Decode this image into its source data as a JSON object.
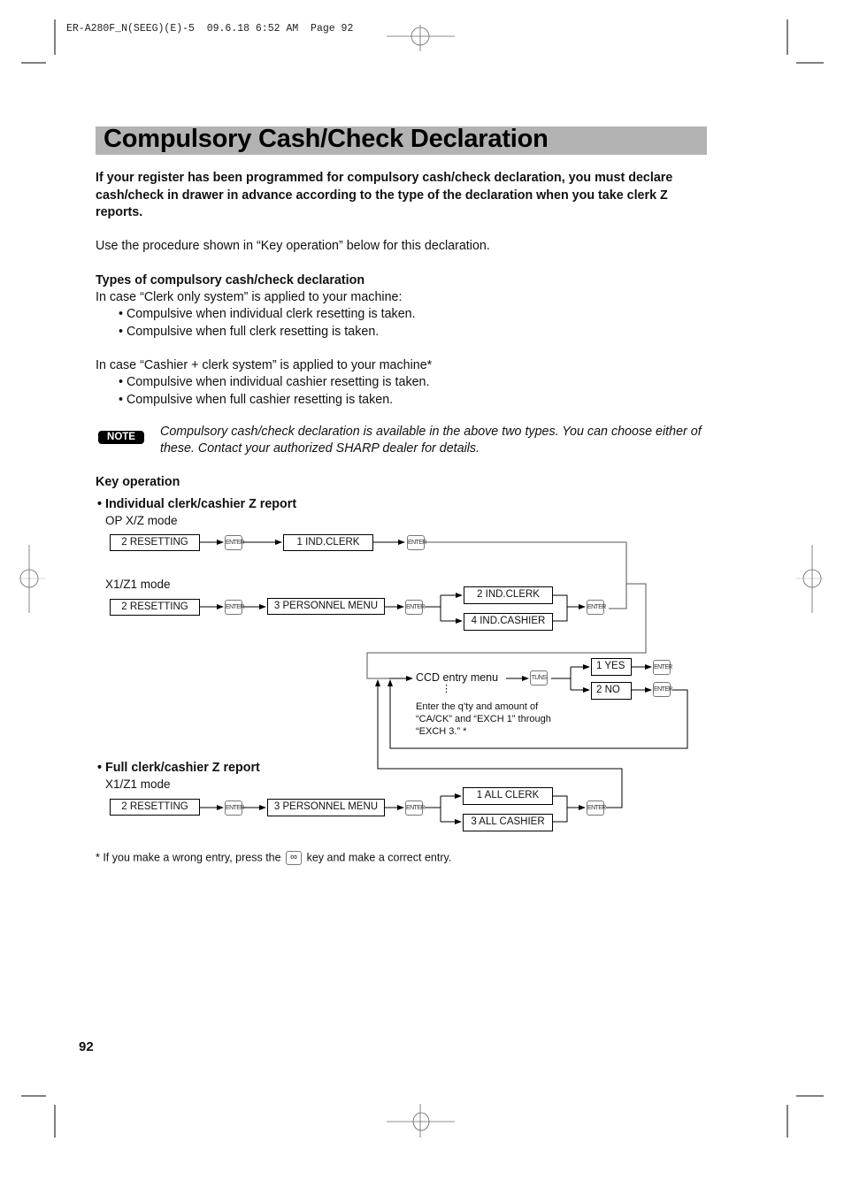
{
  "print_header": "ER-A280F_N(SEEG)(E)-5  09.6.18 6:52 AM  Page 92",
  "title": "Compulsory Cash/Check Declaration",
  "intro": "If your register has been programmed for compulsory cash/check declaration, you must declare cash/check in drawer in advance according to the type of the declaration when you take clerk Z reports.",
  "procedure_note": "Use the procedure shown in “Key operation” below for this declaration.",
  "types": {
    "heading": "Types of compulsory cash/check declaration",
    "clerk_only": {
      "intro": "In case “Clerk only system” is applied to your machine:",
      "bullets": [
        "• Compulsive when individual clerk resetting is taken.",
        "• Compulsive when full clerk resetting is taken."
      ]
    },
    "cashier_clerk": {
      "intro": "In case  “Cashier + clerk system” is applied to your machine*",
      "bullets": [
        "• Compulsive when individual cashier resetting is taken.",
        "• Compulsive when full cashier resetting is taken."
      ]
    }
  },
  "note": {
    "badge": "NOTE",
    "text": "Compulsory cash/check declaration is available in the above two types. You can choose either of these. Contact your authorized SHARP dealer for details."
  },
  "key_operation": {
    "heading": "Key operation",
    "individual": {
      "heading": "• Individual clerk/cashier Z report",
      "op_mode_label": "OP X/Z mode",
      "op_steps": [
        "2  RESETTING",
        "1  IND.CLERK"
      ],
      "x1_mode_label": "X1/Z1 mode",
      "x1_steps": [
        "2  RESETTING",
        "3  PERSONNEL MENU"
      ],
      "x1_branches": [
        "2  IND.CLERK",
        "4  IND.CASHIER"
      ]
    },
    "ccd": {
      "label": "CCD entry menu",
      "dots": "⋮",
      "instruction_lines": [
        "Enter the q’ty and amount of",
        "“CA/CK” and “EXCH 1” through",
        "“EXCH 3.” *"
      ],
      "options": [
        "1 YES",
        "2 NO"
      ]
    },
    "full": {
      "heading": "• Full clerk/cashier Z report",
      "mode_label": "X1/Z1 mode",
      "steps": [
        "2  RESETTING",
        "3  PERSONNEL MENU"
      ],
      "branches": [
        "1 ALL  CLERK",
        "3 ALL  CASHIER"
      ]
    },
    "keys": {
      "enter": "ENTER",
      "tl_ns": "TL/NS",
      "clear": "∞"
    }
  },
  "footnote": {
    "before": "* If you make a wrong entry, press the",
    "after": "key and make a correct entry."
  },
  "page_number": "92"
}
